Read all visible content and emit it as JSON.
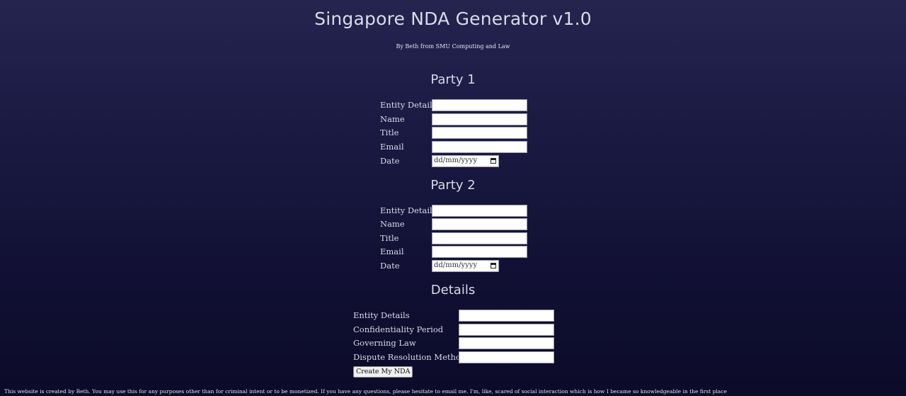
{
  "header": {
    "title": "Singapore NDA Generator v1.0",
    "subtitle": "By Beth from SMU Computing and Law"
  },
  "party1": {
    "heading": "Party 1",
    "fields": {
      "entity_details": {
        "label": "Entity Details",
        "value": ""
      },
      "name": {
        "label": "Name",
        "value": ""
      },
      "title": {
        "label": "Title",
        "value": ""
      },
      "email": {
        "label": "Email",
        "value": ""
      },
      "date": {
        "label": "Date",
        "placeholder": "dd/mm/yyyy"
      }
    }
  },
  "party2": {
    "heading": "Party 2",
    "fields": {
      "entity_details": {
        "label": "Entity Details",
        "value": ""
      },
      "name": {
        "label": "Name",
        "value": ""
      },
      "title": {
        "label": "Title",
        "value": ""
      },
      "email": {
        "label": "Email",
        "value": ""
      },
      "date": {
        "label": "Date",
        "placeholder": "dd/mm/yyyy"
      }
    }
  },
  "details": {
    "heading": "Details",
    "fields": {
      "entity_details": {
        "label": "Entity Details",
        "value": ""
      },
      "confidentiality_period": {
        "label": "Confidentiality Period",
        "value": ""
      },
      "governing_law": {
        "label": "Governing Law",
        "value": ""
      },
      "dispute_resolution": {
        "label": "Dispute Resolution Method",
        "value": ""
      }
    },
    "submit_label": "Create My NDA"
  },
  "footer": {
    "text": "This website is created by Beth. You may use this for any purposes other than for criminal intent or to be monetized. If you have any questions, please hesitate to email me. I'm, like, scared of social interaction which is how I became so knowledgeable in the first place"
  },
  "icons": {
    "date_picker": "calendar-icon"
  },
  "colors": {
    "background_top": "#25244f",
    "background_bottom": "#0c0b29",
    "text": "#dcdcf0",
    "input_background": "#ffffff"
  }
}
